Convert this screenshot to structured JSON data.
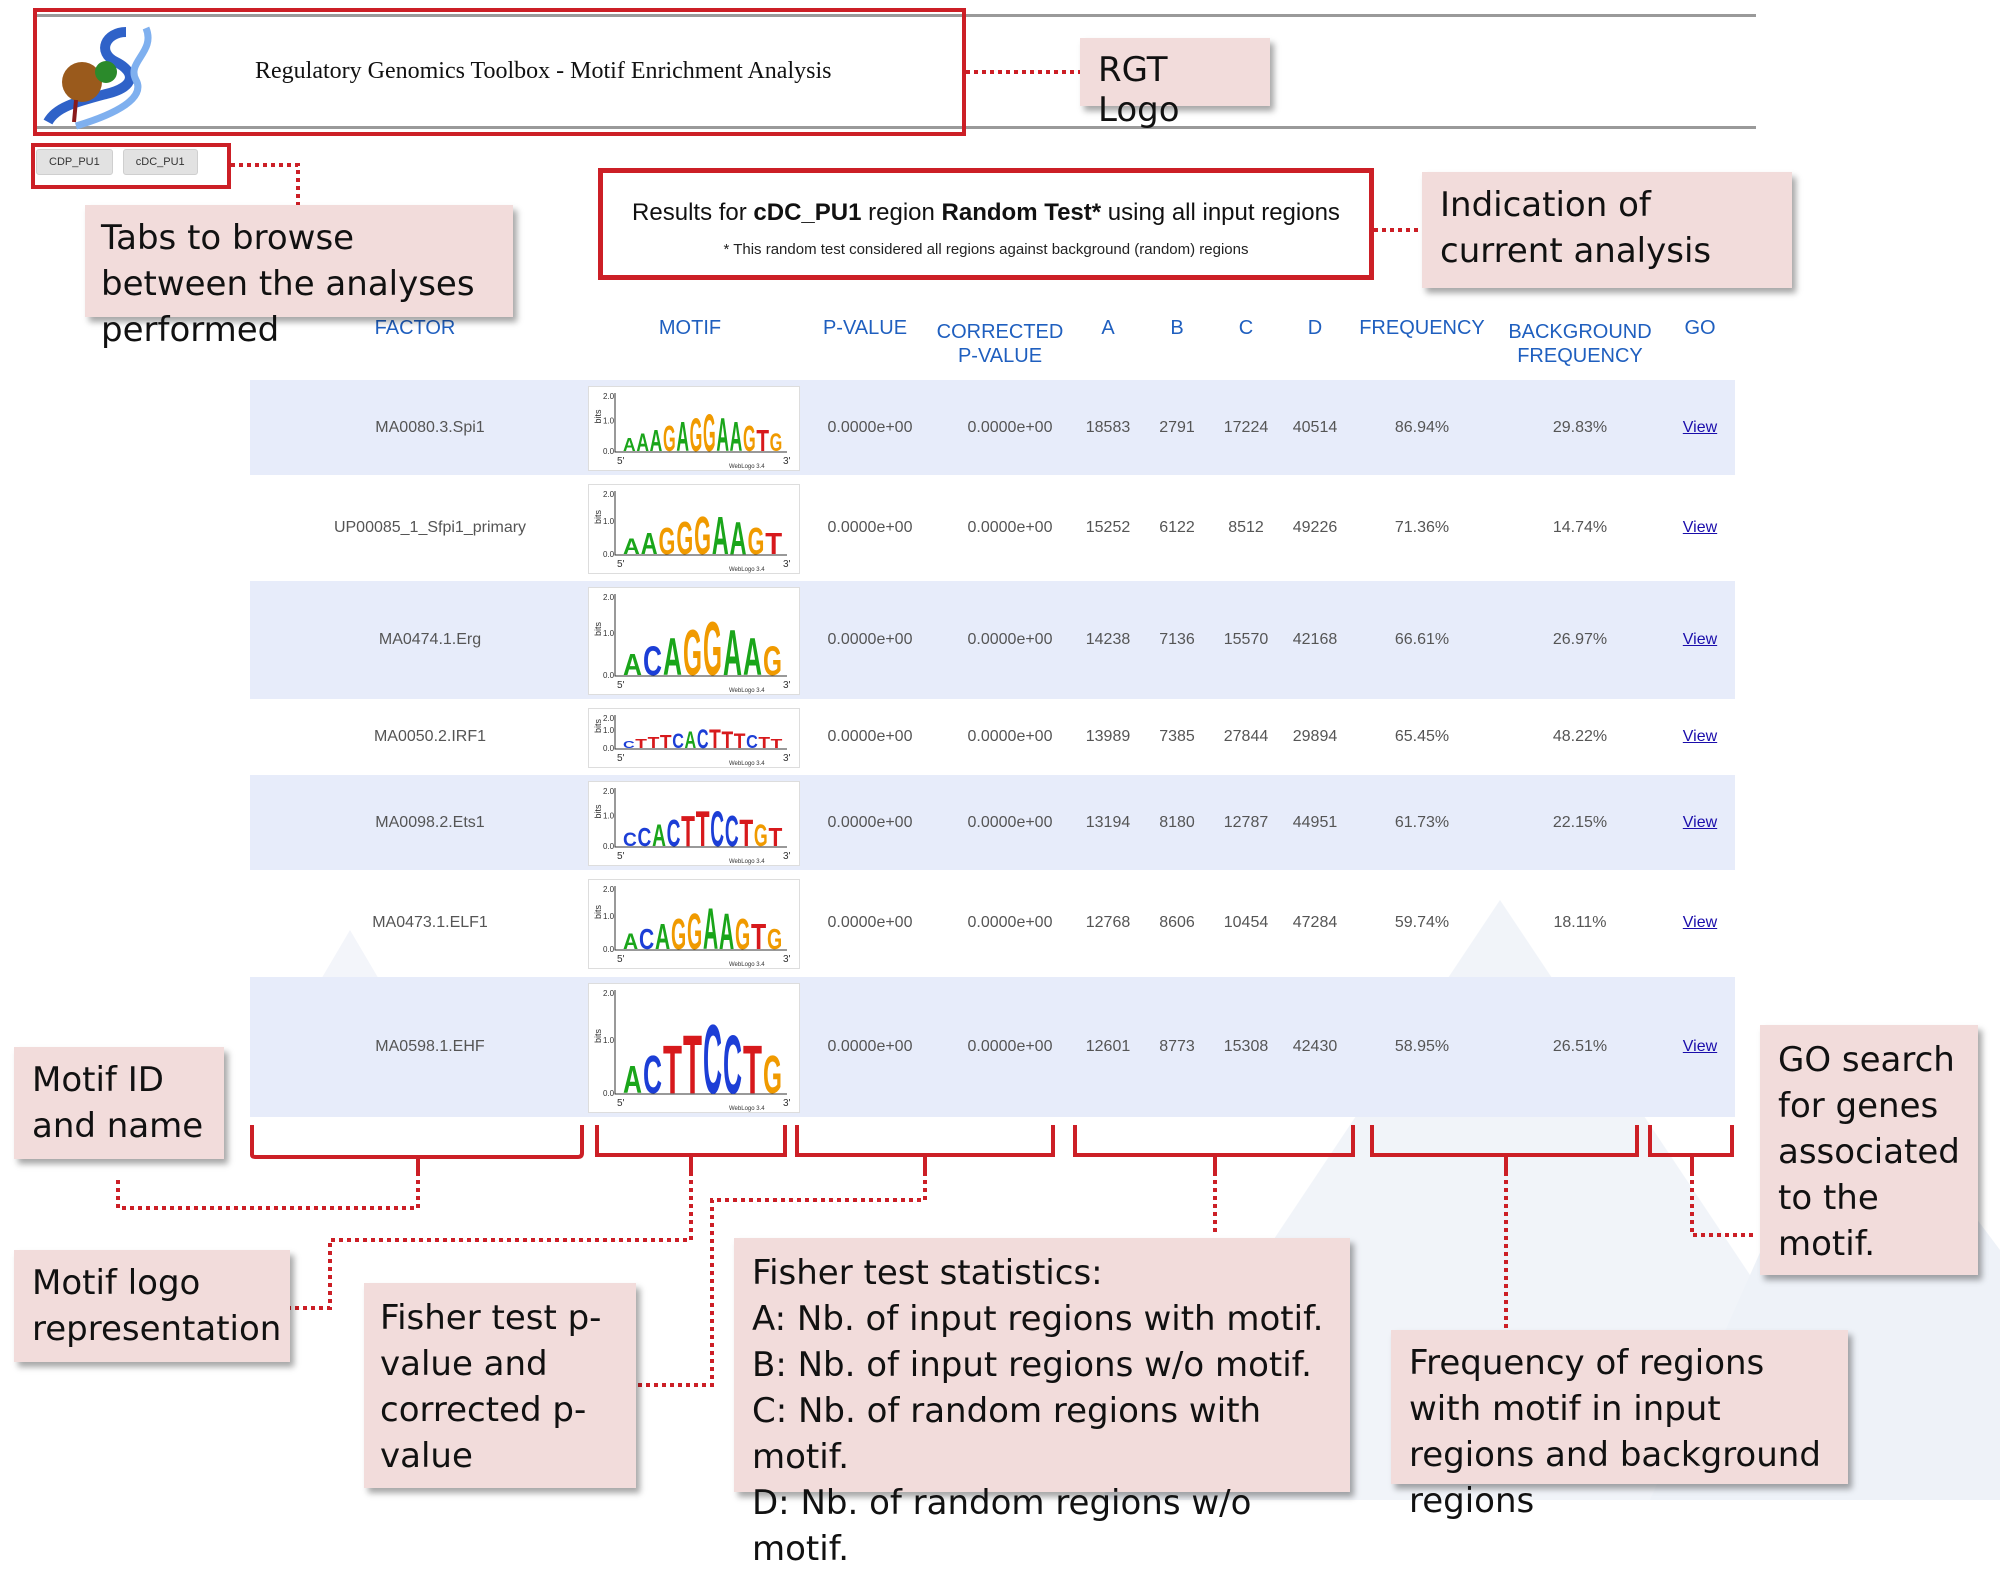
{
  "header": {
    "title": "Regulatory Genomics Toolbox - Motif Enrichment Analysis"
  },
  "tabs": [
    {
      "label": "CDP_PU1"
    },
    {
      "label": "cDC_PU1"
    }
  ],
  "results": {
    "prefix": "Results for ",
    "dataset": "cDC_PU1",
    "mid": " region ",
    "test": "Random Test*",
    "suffix": " using all input regions",
    "note": "* This random test considered all regions against background (random) regions"
  },
  "table": {
    "headers": {
      "factor": "FACTOR",
      "motif": "MOTIF",
      "pvalue": "P-VALUE",
      "corrected_1": "CORRECTED",
      "corrected_2": "P-VALUE",
      "a": "A",
      "b": "B",
      "c": "C",
      "d": "D",
      "frequency": "FREQUENCY",
      "bgfreq_1": "BACKGROUND",
      "bgfreq_2": "FREQUENCY",
      "go": "GO"
    },
    "rows": [
      {
        "factor": "MA0080.3.Spi1",
        "pvalue": "0.0000e+00",
        "corrected": "0.0000e+00",
        "a": "18583",
        "b": "2791",
        "c": "17224",
        "d": "40514",
        "frequency": "86.94%",
        "bg_frequency": "29.83%",
        "go": "View",
        "logo": "AAAGAGGAAGTG",
        "shaded": true
      },
      {
        "factor": "UP00085_1_Sfpi1_primary",
        "pvalue": "0.0000e+00",
        "corrected": "0.0000e+00",
        "a": "15252",
        "b": "6122",
        "c": "8512",
        "d": "49226",
        "frequency": "71.36%",
        "bg_frequency": "14.74%",
        "go": "View",
        "logo": "AAGGGAAGT",
        "shaded": false
      },
      {
        "factor": "MA0474.1.Erg",
        "pvalue": "0.0000e+00",
        "corrected": "0.0000e+00",
        "a": "14238",
        "b": "7136",
        "c": "15570",
        "d": "42168",
        "frequency": "66.61%",
        "bg_frequency": "26.97%",
        "go": "View",
        "logo": "ACAGGAAG",
        "shaded": true
      },
      {
        "factor": "MA0050.2.IRF1",
        "pvalue": "0.0000e+00",
        "corrected": "0.0000e+00",
        "a": "13989",
        "b": "7385",
        "c": "27844",
        "d": "29894",
        "frequency": "65.45%",
        "bg_frequency": "48.22%",
        "go": "View",
        "logo": "CTTTCACTTTCTT",
        "shaded": false
      },
      {
        "factor": "MA0098.2.Ets1",
        "pvalue": "0.0000e+00",
        "corrected": "0.0000e+00",
        "a": "13194",
        "b": "8180",
        "c": "12787",
        "d": "44951",
        "frequency": "61.73%",
        "bg_frequency": "22.15%",
        "go": "View",
        "logo": "CCACTTCCTGT",
        "shaded": true
      },
      {
        "factor": "MA0473.1.ELF1",
        "pvalue": "0.0000e+00",
        "corrected": "0.0000e+00",
        "a": "12768",
        "b": "8606",
        "c": "10454",
        "d": "47284",
        "frequency": "59.74%",
        "bg_frequency": "18.11%",
        "go": "View",
        "logo": "ACAGGAAGTG",
        "shaded": false
      },
      {
        "factor": "MA0598.1.EHF",
        "pvalue": "0.0000e+00",
        "corrected": "0.0000e+00",
        "a": "12601",
        "b": "8773",
        "c": "15308",
        "d": "42430",
        "frequency": "58.95%",
        "bg_frequency": "26.51%",
        "go": "View",
        "logo": "ACTTCCTG",
        "shaded": true
      }
    ]
  },
  "logo_axis": {
    "y_label": "bits",
    "y_ticks": [
      "2.0",
      "1.0",
      "0.0"
    ],
    "x_start": "5'",
    "x_end": "3'",
    "credit": "WebLogo 3.4"
  },
  "callouts": {
    "rgt_logo": "RGT Logo",
    "tabs": "Tabs to browse between the analyses performed",
    "current": "Indication of current analysis",
    "motif_id": "Motif ID and name",
    "motif_logo": "Motif logo representation",
    "fisher_p": "Fisher test p-value and corrected p-value",
    "fisher_stats_title": "Fisher test statistics:",
    "fisher_stats_a": "A: Nb. of input regions with motif.",
    "fisher_stats_b": "B: Nb. of input regions w/o motif.",
    "fisher_stats_c": "C: Nb. of random regions with motif.",
    "fisher_stats_d": "D: Nb. of random regions w/o motif.",
    "frequency": "Frequency of regions with motif in input regions and background regions",
    "go": "GO search for genes associated to the motif."
  },
  "colors": {
    "red": "#cc1f26",
    "callout_bg": "#f2dcdb",
    "header_blue": "#1f5fbf",
    "row_shade": "#e7ecfa",
    "A": "#1aa51a",
    "C": "#1c3ed6",
    "G": "#f09a00",
    "T": "#d7191c"
  }
}
